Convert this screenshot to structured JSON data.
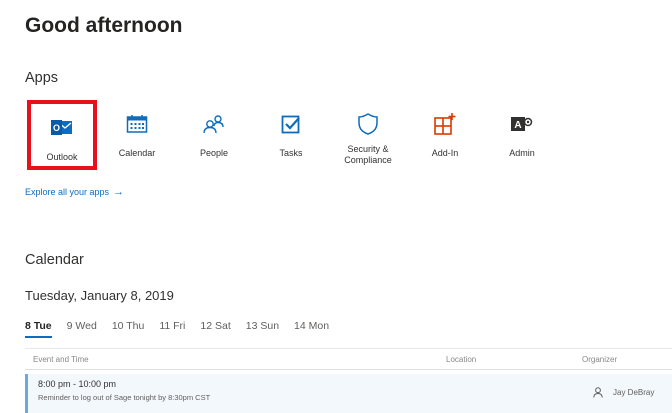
{
  "greeting": "Good afternoon",
  "apps_title": "Apps",
  "apps": [
    {
      "label": "Outlook",
      "icon": "outlook-icon"
    },
    {
      "label": "Calendar",
      "icon": "calendar-icon"
    },
    {
      "label": "People",
      "icon": "people-icon"
    },
    {
      "label": "Tasks",
      "icon": "tasks-icon"
    },
    {
      "label": "Security &\nCompliance",
      "icon": "shield-icon"
    },
    {
      "label": "Add-In",
      "icon": "add-in-icon"
    },
    {
      "label": "Admin",
      "icon": "admin-icon"
    }
  ],
  "explore": {
    "label": "Explore all your apps",
    "arrow": "→"
  },
  "calendar": {
    "title": "Calendar",
    "date": "Tuesday, January 8, 2019",
    "days": [
      "8 Tue",
      "9 Wed",
      "10 Thu",
      "11 Fri",
      "12 Sat",
      "13 Sun",
      "14 Mon"
    ],
    "columns": {
      "event": "Event and Time",
      "location": "Location",
      "organizer": "Organizer"
    },
    "event": {
      "time": "8:00 pm - 10:00 pm",
      "note": "Reminder to log out of Sage tonight by 8:30pm CST",
      "organizer": "Jay DeBray"
    }
  },
  "colors": {
    "accent": "#0f6cbd",
    "highlight": "#e8111b",
    "orange": "#d83b01"
  }
}
